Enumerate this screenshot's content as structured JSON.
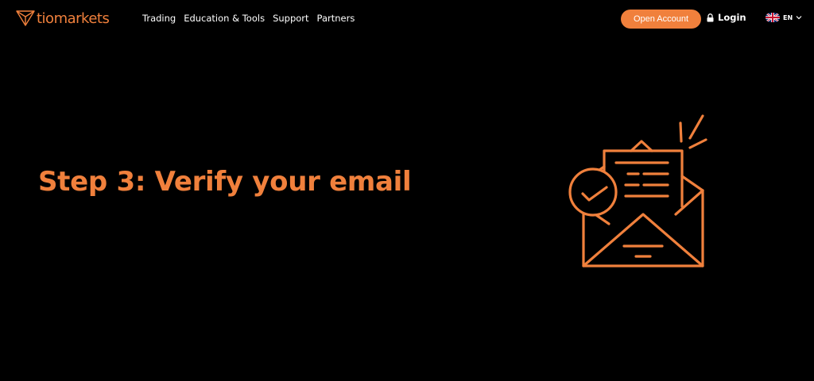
{
  "brand": {
    "name": "tiomarkets",
    "accent": "#f0803c",
    "background": "#000000"
  },
  "nav": {
    "items": [
      {
        "label": "Trading"
      },
      {
        "label": "Education & Tools"
      },
      {
        "label": "Support"
      },
      {
        "label": "Partners"
      }
    ]
  },
  "header_actions": {
    "open_account_label": "Open Account",
    "login_label": "Login",
    "login_icon": "lock-icon",
    "language_label": "EN",
    "language_flag": "uk-flag-icon",
    "language_chevron": "chevron-down-icon"
  },
  "main": {
    "headline": "Step 3: Verify your email",
    "illustration_icon": "open-envelope-checkmark-icon"
  }
}
